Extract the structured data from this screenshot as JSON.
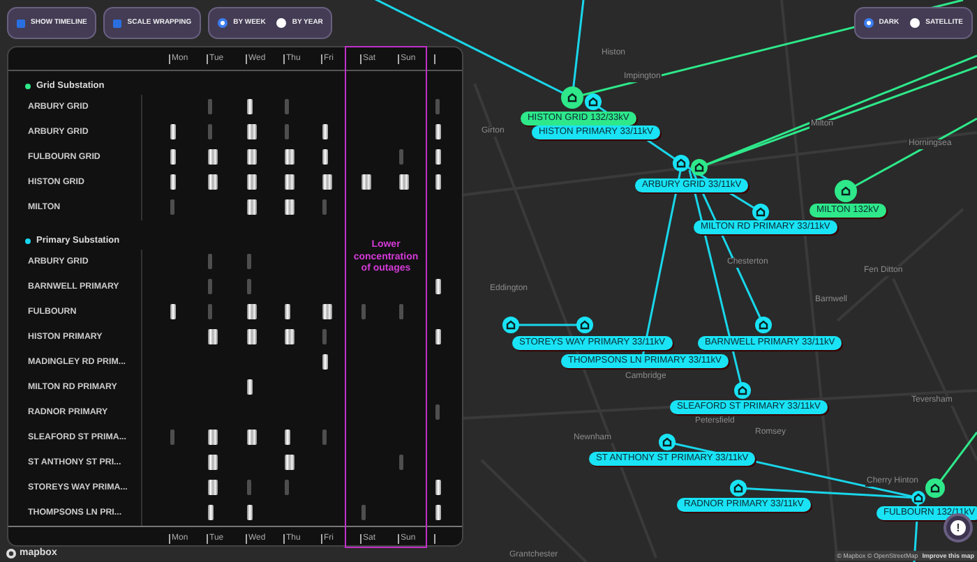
{
  "controls": [
    {
      "kind": "checkbox",
      "label": "SHOW TIMELINE",
      "checked": true
    },
    {
      "kind": "checkbox",
      "label": "SCALE WRAPPING",
      "checked": true
    },
    {
      "kind": "radio",
      "options": [
        {
          "label": "BY WEEK",
          "selected": true
        },
        {
          "label": "BY YEAR",
          "selected": false
        }
      ]
    }
  ],
  "timeline": {
    "top_axis": [
      "Mon",
      "Tue",
      "Wed",
      "Thu",
      "Fri",
      "Sat",
      "Sun"
    ],
    "bottom_axis": [
      "Mon",
      "Tue",
      "Wed",
      "Thu",
      "Fri",
      "Sat",
      "Sun"
    ],
    "groups": [
      {
        "title": "Grid Substation",
        "color": "#2ee88a",
        "rows": [
          {
            "label": "ARBURY GRID"
          },
          {
            "label": "ARBURY GRID"
          },
          {
            "label": "FULBOURN GRID"
          },
          {
            "label": "HISTON GRID"
          },
          {
            "label": "MILTON"
          }
        ]
      },
      {
        "title": "Primary Substation",
        "color": "#19d6f0",
        "rows": [
          {
            "label": "ARBURY GRID"
          },
          {
            "label": "BARNWELL PRIMARY"
          },
          {
            "label": "FULBOURN"
          },
          {
            "label": "HISTON PRIMARY"
          },
          {
            "label": "MADINGLEY RD PRIM..."
          },
          {
            "label": "MILTON RD PRIMARY"
          },
          {
            "label": "RADNOR PRIMARY"
          },
          {
            "label": "SLEAFORD ST PRIMA..."
          },
          {
            "label": "ST ANTHONY ST PRI..."
          },
          {
            "label": "STOREYS WAY PRIMA..."
          },
          {
            "label": "THOMPSONS LN PRI..."
          }
        ]
      }
    ],
    "highlight": {
      "note": "Lower concentration of outages"
    }
  },
  "map": {
    "style_options": [
      {
        "label": "DARK",
        "selected": true
      },
      {
        "label": "SATELLITE",
        "selected": false
      }
    ],
    "places": [
      "Histon",
      "Impington",
      "Girton",
      "Milton",
      "Horningsea",
      "Chesterton",
      "Fen Ditton",
      "Eddington",
      "Barnwell",
      "Cambridge",
      "Petersfield",
      "Romsey",
      "Newnham",
      "Teversham",
      "Cherry Hinton",
      "Grantchester"
    ],
    "markers": [
      {
        "kind": "grid"
      },
      {
        "kind": "primary"
      },
      {
        "kind": "primary"
      },
      {
        "kind": "grid"
      },
      {
        "kind": "primary"
      },
      {
        "kind": "grid"
      },
      {
        "kind": "primary"
      },
      {
        "kind": "primary"
      },
      {
        "kind": "primary"
      },
      {
        "kind": "primary"
      },
      {
        "kind": "primary"
      },
      {
        "kind": "primary"
      },
      {
        "kind": "grid"
      },
      {
        "kind": "primary"
      }
    ],
    "labels": [
      {
        "kind": "grid",
        "text": "HISTON GRID 132/33kV"
      },
      {
        "kind": "primary",
        "text": "HISTON PRIMARY 33/11kV"
      },
      {
        "kind": "primary",
        "text": "ARBURY GRID 33/11kV"
      },
      {
        "kind": "grid",
        "text": "MILTON 132kV"
      },
      {
        "kind": "primary",
        "text": "MILTON RD PRIMARY 33/11kV"
      },
      {
        "kind": "primary",
        "text": "STOREYS WAY PRIMARY 33/11kV"
      },
      {
        "kind": "primary",
        "text": "BARNWELL PRIMARY 33/11kV"
      },
      {
        "kind": "primary",
        "text": "THOMPSONS LN PRIMARY 33/11kV"
      },
      {
        "kind": "primary",
        "text": "SLEAFORD ST PRIMARY 33/11kV"
      },
      {
        "kind": "primary",
        "text": "ST ANTHONY ST PRIMARY 33/11kV"
      },
      {
        "kind": "primary",
        "text": "RADNOR PRIMARY 33/11kV"
      },
      {
        "kind": "primary",
        "text": "FULBOURN 132/11kV"
      }
    ],
    "logo": "mapbox",
    "attribution": "© Mapbox © OpenStreetMap",
    "improve_link": "Improve this map",
    "feedback_button": "!"
  }
}
